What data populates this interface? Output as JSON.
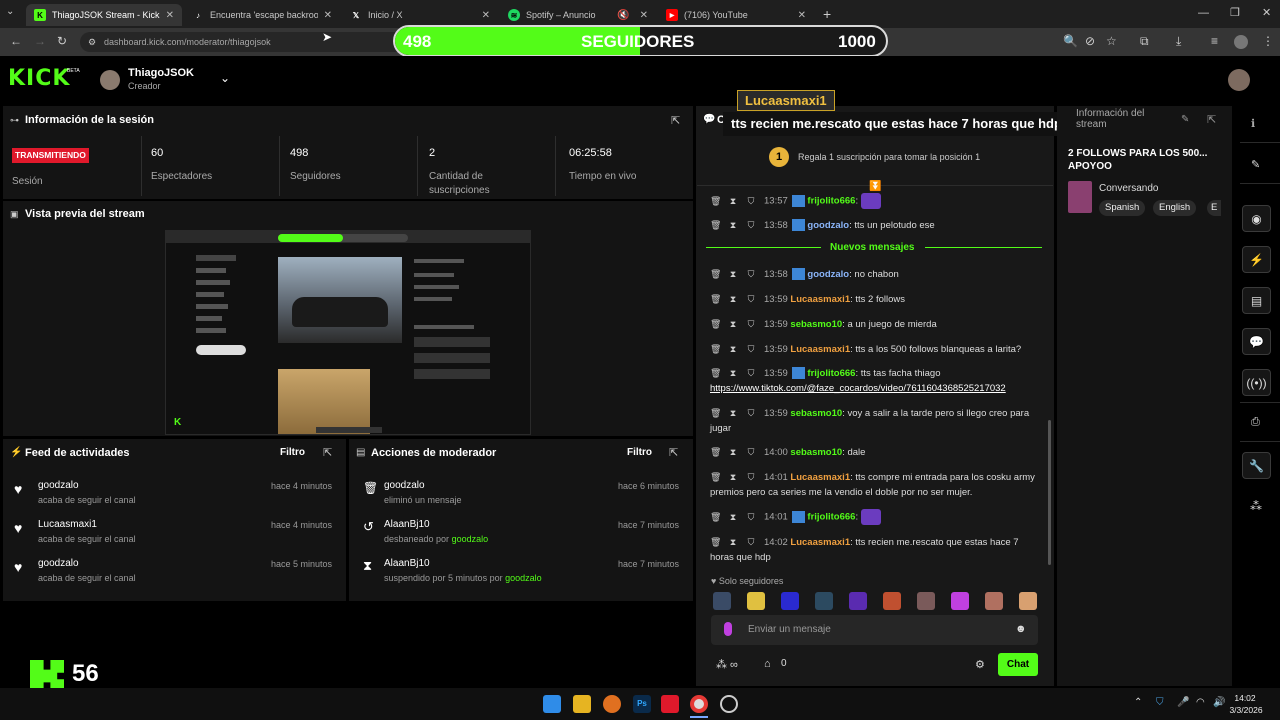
{
  "browser": {
    "tabs": [
      {
        "title": "ThiagoJSOK Stream - Kick Dashb",
        "icon": "kick-icon",
        "color": "#53fc18"
      },
      {
        "title": "Encuentra 'escape backrooms' t",
        "icon": "tiktok-icon",
        "color": "#ffffff"
      },
      {
        "title": "Inicio / X",
        "icon": "x-icon",
        "color": "#ffffff"
      },
      {
        "title": "Spotify – Anuncio",
        "icon": "spotify-icon",
        "color": "#1ed760"
      },
      {
        "title": "(7106) YouTube",
        "icon": "youtube-icon",
        "color": "#ff0000"
      }
    ],
    "url": "dashboard.kick.com/moderator/thiagojsok"
  },
  "overlay": {
    "current": "498",
    "label": "SEGUIDORES",
    "goal": "1000",
    "progress": 0.498,
    "tts_user": "Lucaasmaxi1",
    "tts_message": "tts recien me.rescato que estas hace 7 horas que hdp"
  },
  "header": {
    "logo": "KICK",
    "beta": "BETA",
    "username": "ThiagoJSOK",
    "role": "Creador"
  },
  "session": {
    "title": "Información de la sesión",
    "live_badge": "TRANSMITIENDO",
    "session_label": "Sesión",
    "stats": [
      {
        "value": "60",
        "label": "Espectadores"
      },
      {
        "value": "498",
        "label": "Seguidores"
      },
      {
        "value": "2",
        "label": "Cantidad de suscripciones"
      },
      {
        "value": "06:25:58",
        "label": "Tiempo en vivo"
      }
    ]
  },
  "preview": {
    "title": "Vista previa del stream"
  },
  "feed": {
    "title": "Feed de actividades",
    "filter": "Filtro",
    "items": [
      {
        "user": "goodzalo",
        "action": "acaba de seguir el canal",
        "time": "hace 4 minutos"
      },
      {
        "user": "Lucaasmaxi1",
        "action": "acaba de seguir el canal",
        "time": "hace 4 minutos"
      },
      {
        "user": "goodzalo",
        "action": "acaba de seguir el canal",
        "time": "hace 5 minutos"
      }
    ]
  },
  "mod": {
    "title": "Acciones de moderador",
    "filter": "Filtro",
    "items": [
      {
        "user": "goodzalo",
        "action": "eliminó un mensaje",
        "by": "",
        "time": "hace 6 minutos",
        "icon": "trash-icon"
      },
      {
        "user": "AlaanBj10",
        "action": "desbaneado por ",
        "by": "goodzalo",
        "time": "hace 7 minutos",
        "icon": "undo-icon"
      },
      {
        "user": "AlaanBj10",
        "action": "suspendido por 5 minutos por ",
        "by": "goodzalo",
        "time": "hace 7 minutos",
        "icon": "hourglass-icon"
      }
    ]
  },
  "chat": {
    "title": "Ch",
    "gift_rank": "1",
    "gift_text": "Regala 1 suscripción para tomar la posición 1",
    "new_messages": "Nuevos mensajes",
    "messages": [
      {
        "time": "13:57",
        "user": "frijolito666",
        "text": "",
        "color": "#53fc18"
      },
      {
        "time": "13:58",
        "user": "goodzalo",
        "text": "tts un pelotudo ese",
        "color": "#8ab4f8"
      },
      {
        "time": "13:58",
        "user": "goodzalo",
        "text": "no chabon",
        "color": "#8ab4f8"
      },
      {
        "time": "13:59",
        "user": "Lucaasmaxi1",
        "text": "tts 2 follows",
        "color": "#f0a040"
      },
      {
        "time": "13:59",
        "user": "sebasmo10",
        "text": "a un juego de mierda",
        "color": "#53fc18"
      },
      {
        "time": "13:59",
        "user": "Lucaasmaxi1",
        "text": "tts a los 500 follows blanqueas a larita?",
        "color": "#f0a040"
      },
      {
        "time": "13:59",
        "user": "frijolito666",
        "text": "tts tas facha thiago",
        "link": "https://www.tiktok.com/@faze_cocardos/video/7611604368525217032",
        "color": "#53fc18"
      },
      {
        "time": "13:59",
        "user": "sebasmo10",
        "text": "voy a salir a la tarde pero si llego creo para jugar",
        "color": "#53fc18"
      },
      {
        "time": "14:00",
        "user": "sebasmo10",
        "text": "dale",
        "color": "#53fc18"
      },
      {
        "time": "14:01",
        "user": "Lucaasmaxi1",
        "text": "tts compre mi entrada para los cosku army premios pero ca series me la vendio el doble por no ser mujer.",
        "color": "#f0a040"
      },
      {
        "time": "14:01",
        "user": "frijolito666",
        "text": "",
        "color": "#53fc18"
      },
      {
        "time": "14:02",
        "user": "Lucaasmaxi1",
        "text": "tts recien me.rescato que estas hace 7 horas que hdp",
        "color": "#f0a040"
      }
    ],
    "followers_only": "Solo seguidores",
    "input_placeholder": "Enviar un mensaje",
    "points": "0",
    "send": "Chat"
  },
  "info": {
    "title": "Información del stream",
    "stream_title": "2 FOLLOWS PARA LOS 500... APOYOO",
    "category": "Conversando",
    "tags": [
      "Spanish",
      "English",
      "E"
    ]
  },
  "webcam": {
    "logo": "K",
    "count": "56"
  },
  "taskbar": {
    "time": "14:02",
    "date": "3/3/2026"
  }
}
